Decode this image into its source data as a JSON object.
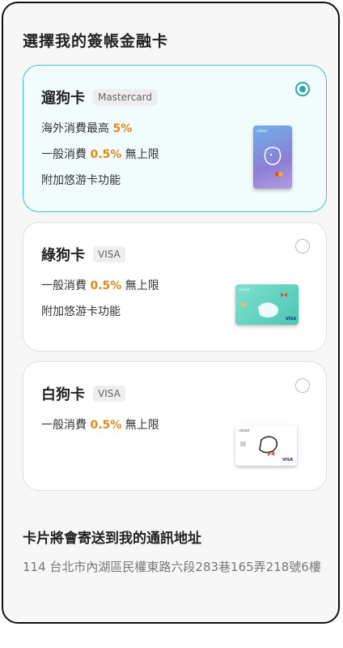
{
  "page_title": "選擇我的簽帳金融卡",
  "cards": [
    {
      "name": "遛狗卡",
      "network": "Mastercard",
      "selected": true,
      "features": [
        {
          "pre": "海外消費最高 ",
          "hl": "5%",
          "post": ""
        },
        {
          "pre": "一般消費 ",
          "hl": "0.5%",
          "post": " 無上限"
        },
        {
          "pre": "附加悠游卡功能",
          "hl": "",
          "post": ""
        }
      ],
      "card_image": {
        "style": "vertical",
        "color": "#8a7fd6"
      }
    },
    {
      "name": "綠狗卡",
      "network": "VISA",
      "selected": false,
      "features": [
        {
          "pre": "一般消費 ",
          "hl": "0.5%",
          "post": " 無上限"
        },
        {
          "pre": "附加悠游卡功能",
          "hl": "",
          "post": ""
        }
      ],
      "card_image": {
        "style": "horizontal",
        "color": "#5fd0be"
      }
    },
    {
      "name": "白狗卡",
      "network": "VISA",
      "selected": false,
      "features": [
        {
          "pre": "一般消費 ",
          "hl": "0.5%",
          "post": " 無上限"
        }
      ],
      "card_image": {
        "style": "horizontal",
        "color": "#ffffff"
      }
    }
  ],
  "address": {
    "title": "卡片將會寄送到我的通訊地址",
    "text": "114 台北市內湖區民權東路六段283巷165弄218號6樓"
  },
  "colors": {
    "accent": "#2aa8a8",
    "highlight": "#e08a1e"
  }
}
